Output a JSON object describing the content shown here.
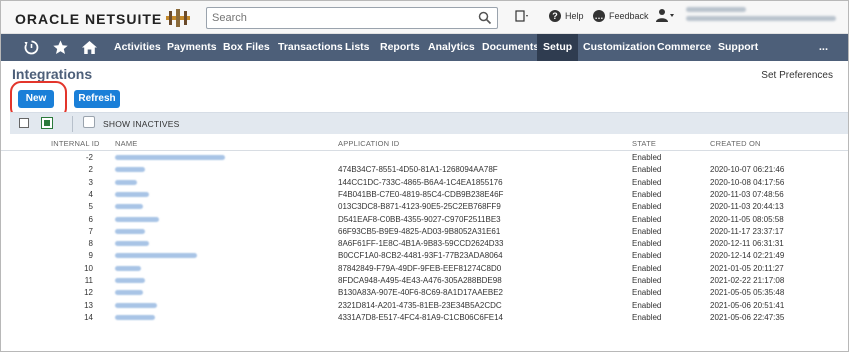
{
  "header": {
    "logo_oracle": "ORACLE",
    "logo_netsuite": "NETSUITE",
    "search_placeholder": "Search",
    "help_label": "Help",
    "feedback_label": "Feedback"
  },
  "nav": {
    "items": [
      "Activities",
      "Payments",
      "Box Files",
      "Transactions",
      "Lists",
      "Reports",
      "Analytics",
      "Documents",
      "Setup",
      "Customization",
      "Commerce",
      "Support"
    ],
    "active": "Setup",
    "more": "..."
  },
  "page": {
    "title": "Integrations",
    "set_preferences": "Set Preferences",
    "new_button": "New",
    "refresh_button": "Refresh",
    "show_inactives": "SHOW INACTIVES"
  },
  "table": {
    "headers": [
      "INTERNAL ID",
      "NAME",
      "APPLICATION ID",
      "STATE",
      "CREATED ON"
    ],
    "rows": [
      {
        "id": "-2",
        "app_id": "",
        "state": "Enabled",
        "created": ""
      },
      {
        "id": "2",
        "app_id": "474B34C7-8551-4D50-81A1-1268094AA78F",
        "state": "Enabled",
        "created": "2020-10-07 06:21:46"
      },
      {
        "id": "3",
        "app_id": "144CC1DC-733C-4865-B6A4-1C4EA1855176",
        "state": "Enabled",
        "created": "2020-10-08 04:17:56"
      },
      {
        "id": "4",
        "app_id": "F4B041BB-C7E0-4819-85C4-CDB9B238E46F",
        "state": "Enabled",
        "created": "2020-11-03 07:48:56"
      },
      {
        "id": "5",
        "app_id": "013C3DC8-B871-4123-90E5-25C2EB768FF9",
        "state": "Enabled",
        "created": "2020-11-03 20:44:13"
      },
      {
        "id": "6",
        "app_id": "D541EAF8-C0BB-4355-9027-C970F2511BE3",
        "state": "Enabled",
        "created": "2020-11-05 08:05:58"
      },
      {
        "id": "7",
        "app_id": "66F93CB5-B9E9-4825-AD03-9B8052A31E61",
        "state": "Enabled",
        "created": "2020-11-17 23:37:17"
      },
      {
        "id": "8",
        "app_id": "8A6F61FF-1E8C-4B1A-9B83-59CCD2624D33",
        "state": "Enabled",
        "created": "2020-12-11 06:31:31"
      },
      {
        "id": "9",
        "app_id": "B0CCF1A0-8CB2-4481-93F1-77B23ADA8064",
        "state": "Enabled",
        "created": "2020-12-14 02:21:49"
      },
      {
        "id": "10",
        "app_id": "87842849-F79A-49DF-9FEB-EEF81274C8D0",
        "state": "Enabled",
        "created": "2021-01-05 20:11:27"
      },
      {
        "id": "11",
        "app_id": "8FDCA948-A495-4E43-A476-305A288BDE98",
        "state": "Enabled",
        "created": "2021-02-22 21:17:08"
      },
      {
        "id": "12",
        "app_id": "B130A83A-907E-40F6-8C69-8A1D17AAEBE2",
        "state": "Enabled",
        "created": "2021-05-05 05:35:48"
      },
      {
        "id": "13",
        "app_id": "2321D814-A201-4735-81EB-23E34B5A2CDC",
        "state": "Enabled",
        "created": "2021-05-06 20:51:41"
      },
      {
        "id": "14",
        "app_id": "4331A7D8-E517-4FC4-81A9-C1CB06C6FE14",
        "state": "Enabled",
        "created": "2021-05-06 22:47:35"
      }
    ]
  },
  "colors": {
    "nav_bg": "#4d5f79",
    "nav_active": "#2f3c50",
    "button": "#1a7fd8",
    "highlight": "#e3352b",
    "filter_bar": "#e2e8ef"
  }
}
